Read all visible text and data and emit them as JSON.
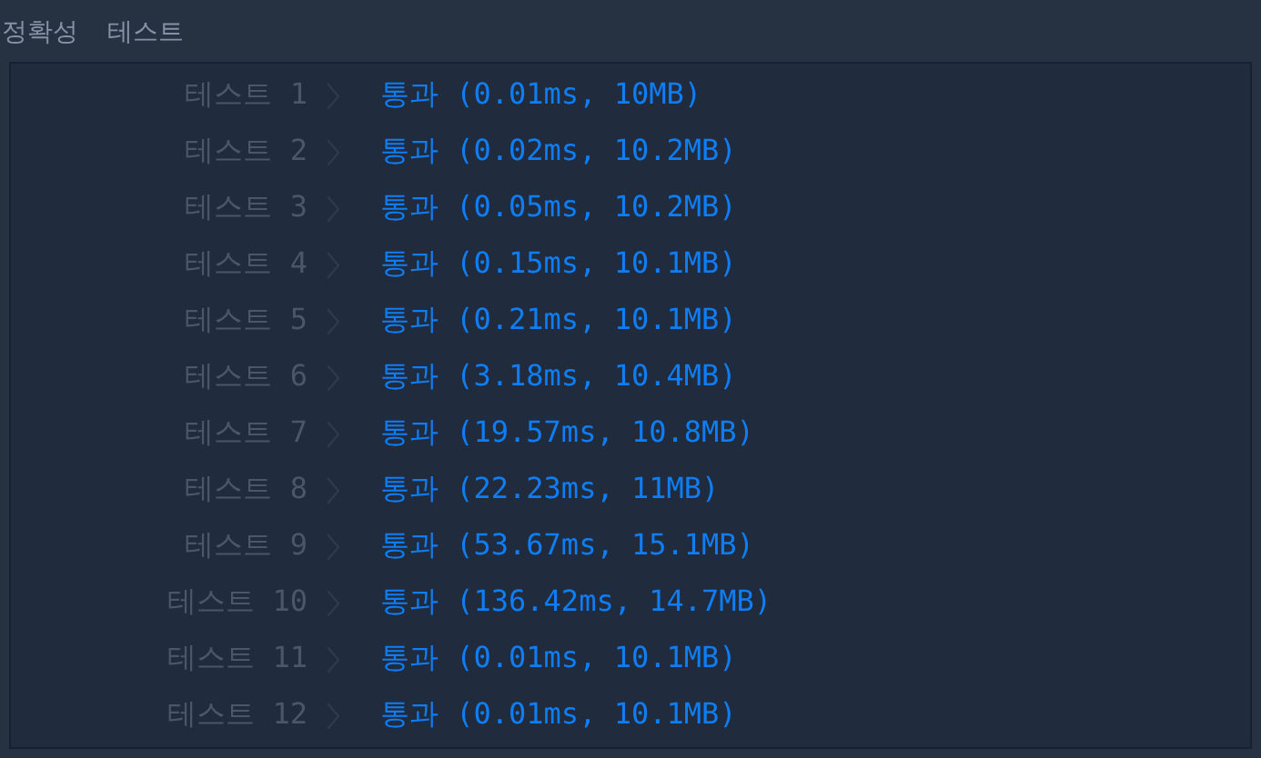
{
  "header": {
    "title": "정확성",
    "subtitle": "테스트"
  },
  "rows": [
    {
      "label": "테스트 1",
      "result": "통과 (0.01ms, 10MB)"
    },
    {
      "label": "테스트 2",
      "result": "통과 (0.02ms, 10.2MB)"
    },
    {
      "label": "테스트 3",
      "result": "통과 (0.05ms, 10.2MB)"
    },
    {
      "label": "테스트 4",
      "result": "통과 (0.15ms, 10.1MB)"
    },
    {
      "label": "테스트 5",
      "result": "통과 (0.21ms, 10.1MB)"
    },
    {
      "label": "테스트 6",
      "result": "통과 (3.18ms, 10.4MB)"
    },
    {
      "label": "테스트 7",
      "result": "통과 (19.57ms, 10.8MB)"
    },
    {
      "label": "테스트 8",
      "result": "통과 (22.23ms, 11MB)"
    },
    {
      "label": "테스트 9",
      "result": "통과 (53.67ms, 15.1MB)"
    },
    {
      "label": "테스트 10",
      "result": "통과 (136.42ms, 14.7MB)"
    },
    {
      "label": "테스트 11",
      "result": "통과 (0.01ms, 10.1MB)"
    },
    {
      "label": "테스트 12",
      "result": "통과 (0.01ms, 10.1MB)"
    }
  ]
}
